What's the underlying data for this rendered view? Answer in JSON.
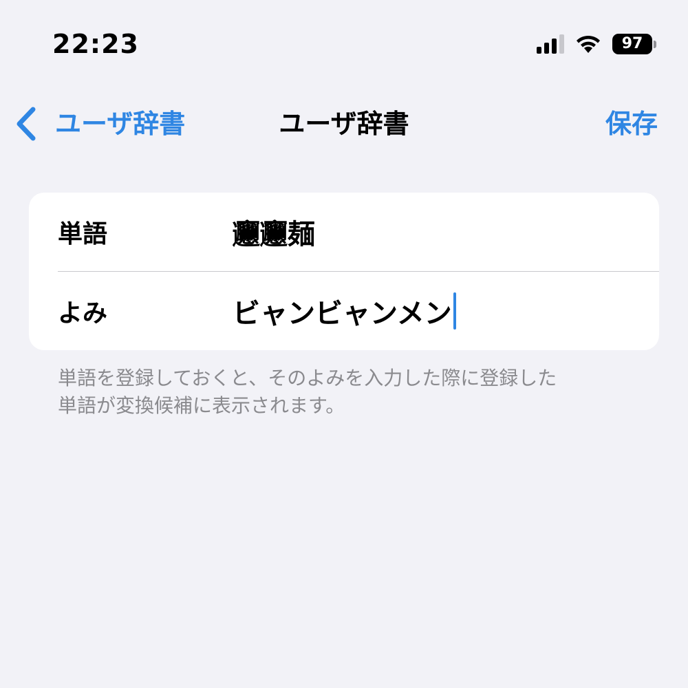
{
  "status_bar": {
    "time": "22:23",
    "battery": "97",
    "signal_icon": "cellular-signal-icon",
    "wifi_icon": "wifi-icon",
    "battery_icon": "battery-icon"
  },
  "nav": {
    "back_label": "ユーザ辞書",
    "title": "ユーザ辞書",
    "save_label": "保存",
    "accent_color": "#2f86e3"
  },
  "form": {
    "word_label": "単語",
    "word_value": "𰻞𰻞麺",
    "reading_label": "よみ",
    "reading_value": "ビャンビャンメン"
  },
  "footnote": {
    "line1": "単語を登録しておくと、そのよみを入力した際に登録した",
    "line2": "単語が変換候補に表示されます。"
  }
}
